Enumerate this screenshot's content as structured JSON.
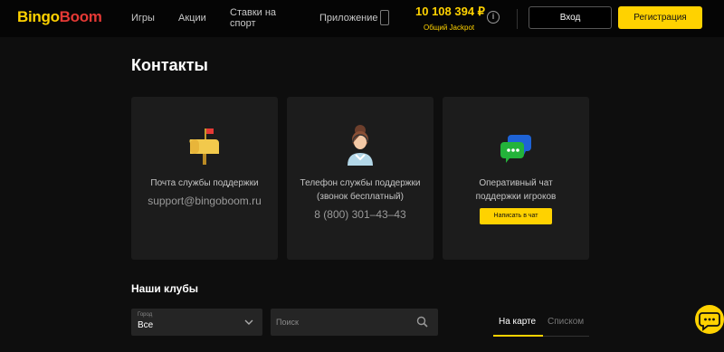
{
  "header": {
    "logo_part1": "Bingo",
    "logo_part2": "Boom",
    "nav": {
      "games": "Игры",
      "promo": "Акции",
      "sport_line1": "Ставки на",
      "sport_line2": "спорт",
      "app": "Приложение"
    },
    "jackpot_amount": "10 108 394 ₽",
    "jackpot_label": "Общий Jackpot",
    "login_label": "Вход",
    "register_label": "Регистрация"
  },
  "page": {
    "title": "Контакты"
  },
  "cards": {
    "email": {
      "label": "Почта службы поддержки",
      "value": "support@bingoboom.ru"
    },
    "phone": {
      "label_line1": "Телефон службы поддержки",
      "label_line2": "(звонок бесплатный)",
      "value": "8 (800) 301–43–43"
    },
    "chat": {
      "label_line1": "Оперативный чат",
      "label_line2": "поддержки игроков",
      "button_label": "Написать в чат"
    }
  },
  "clubs": {
    "title": "Наши клубы",
    "city_label": "Город",
    "city_value": "Все",
    "search_placeholder": "Поиск",
    "tabs": {
      "map": "На карте",
      "list": "Списком"
    }
  },
  "colors": {
    "accent": "#ffd200",
    "background": "#0e0e0e",
    "card": "#1c1c1c",
    "logo_red": "#e53935"
  },
  "icons": {
    "mailbox": "mailbox-icon",
    "operator": "support-operator-icon",
    "chat": "chat-bubbles-icon",
    "phone": "mobile-phone-icon",
    "info": "info-icon",
    "search": "search-icon",
    "chevron": "chevron-down-icon",
    "support_fab": "support-chat-icon"
  }
}
